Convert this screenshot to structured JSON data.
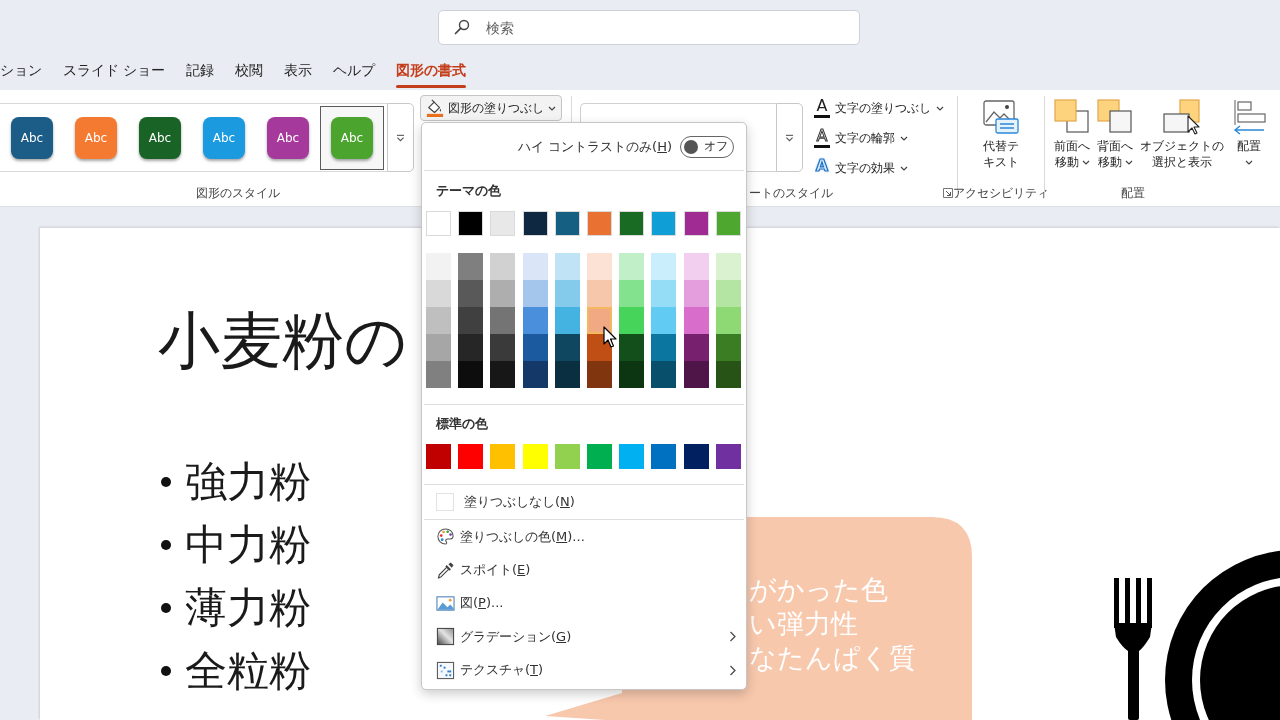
{
  "search": {
    "placeholder": "検索"
  },
  "tabs": [
    {
      "label": "ション",
      "selected": false
    },
    {
      "label": "スライド ショー",
      "selected": false
    },
    {
      "label": "記録",
      "selected": false
    },
    {
      "label": "校閲",
      "selected": false
    },
    {
      "label": "表示",
      "selected": false
    },
    {
      "label": "ヘルプ",
      "selected": false
    },
    {
      "label": "図形の書式",
      "selected": true
    }
  ],
  "ribbon": {
    "shape_styles": {
      "options": [
        {
          "label": "Abc",
          "color": "#1b5d87",
          "selected": false
        },
        {
          "label": "Abc",
          "color": "#f47a32",
          "selected": false
        },
        {
          "label": "Abc",
          "color": "#1a6326",
          "selected": false
        },
        {
          "label": "Abc",
          "color": "#1c9ae0",
          "selected": false
        },
        {
          "label": "Abc",
          "color": "#a63a9c",
          "selected": false
        },
        {
          "label": "Abc",
          "color": "#4aa42e",
          "selected": true
        }
      ],
      "label": "図形のスタイル"
    },
    "shape_fill_button": {
      "label": "図形の塗りつぶし",
      "dropdown": true
    },
    "wordart_styles": {
      "label": "ートのスタイル"
    },
    "text_buttons": [
      {
        "kind": "fill",
        "glyph": "A",
        "label": "文字の塗りつぶし",
        "dropdown": true
      },
      {
        "kind": "outline",
        "glyph": "A",
        "label": "文字の輪郭",
        "dropdown": true
      },
      {
        "kind": "effects",
        "glyph": "A",
        "label": "文字の効果",
        "dropdown": true
      }
    ],
    "accessibility": {
      "button": {
        "lines": [
          "代替テ",
          "キスト"
        ]
      },
      "label": "アクセシビリティ"
    },
    "arrange": {
      "buttons": [
        {
          "kind": "bring_forward",
          "lines": [
            "前面へ",
            "移動"
          ],
          "dropdown": true
        },
        {
          "kind": "send_backward",
          "lines": [
            "背面へ",
            "移動"
          ],
          "dropdown": true
        },
        {
          "kind": "selection_pane",
          "lines": [
            "オブジェクトの",
            "選択と表示"
          ],
          "dropdown": false
        },
        {
          "kind": "align",
          "lines": [
            "配置"
          ],
          "dropdown": true
        }
      ],
      "label": "配置"
    }
  },
  "fill_menu": {
    "high_contrast": {
      "label_before": "ハイ コントラストのみ(",
      "access_key": "H",
      "label_after": ")",
      "on": false,
      "state_text": "オフ"
    },
    "theme_colors": {
      "title": "テーマの色",
      "columns": [
        {
          "color": "#ffffff",
          "shades": [
            {
              "color": "#f2f2f2",
              "hovered": false
            },
            {
              "color": "#d9d9d9",
              "hovered": false
            },
            {
              "color": "#bfbfbf",
              "hovered": false
            },
            {
              "color": "#a6a6a6",
              "hovered": false
            },
            {
              "color": "#808080",
              "hovered": false
            }
          ]
        },
        {
          "color": "#000000",
          "shades": [
            {
              "color": "#7f7f7f",
              "hovered": false
            },
            {
              "color": "#595959",
              "hovered": false
            },
            {
              "color": "#404040",
              "hovered": false
            },
            {
              "color": "#262626",
              "hovered": false
            },
            {
              "color": "#0d0d0d",
              "hovered": false
            }
          ]
        },
        {
          "color": "#e8e8e8",
          "shades": [
            {
              "color": "#d1d1d1",
              "hovered": false
            },
            {
              "color": "#aeaeae",
              "hovered": false
            },
            {
              "color": "#747474",
              "hovered": false
            },
            {
              "color": "#3a3a3a",
              "hovered": false
            },
            {
              "color": "#171717",
              "hovered": false
            }
          ]
        },
        {
          "color": "#0e2841",
          "shades": [
            {
              "color": "#dae6f7",
              "hovered": false
            },
            {
              "color": "#a4c6ec",
              "hovered": false
            },
            {
              "color": "#4a8fdc",
              "hovered": false
            },
            {
              "color": "#1c5aa0",
              "hovered": false
            },
            {
              "color": "#143868",
              "hovered": false
            }
          ]
        },
        {
          "color": "#156082",
          "shades": [
            {
              "color": "#c0e4f5",
              "hovered": false
            },
            {
              "color": "#83caeb",
              "hovered": false
            },
            {
              "color": "#44b3e1",
              "hovered": false
            },
            {
              "color": "#0f4761",
              "hovered": false
            },
            {
              "color": "#0a2f41",
              "hovered": false
            }
          ]
        },
        {
          "color": "#e97132",
          "shades": [
            {
              "color": "#fbe2d5",
              "hovered": false
            },
            {
              "color": "#f7c7ac",
              "hovered": false
            },
            {
              "color": "#f1a983",
              "hovered": true
            },
            {
              "color": "#c04f15",
              "hovered": false
            },
            {
              "color": "#80350e",
              "hovered": false
            }
          ]
        },
        {
          "color": "#196b24",
          "shades": [
            {
              "color": "#c1f0c8",
              "hovered": false
            },
            {
              "color": "#83e28e",
              "hovered": false
            },
            {
              "color": "#47d45a",
              "hovered": false
            },
            {
              "color": "#124f1a",
              "hovered": false
            },
            {
              "color": "#0c3512",
              "hovered": false
            }
          ]
        },
        {
          "color": "#0f9ed5",
          "shades": [
            {
              "color": "#caeefb",
              "hovered": false
            },
            {
              "color": "#95dcf7",
              "hovered": false
            },
            {
              "color": "#61cbf3",
              "hovered": false
            },
            {
              "color": "#0b76a0",
              "hovered": false
            },
            {
              "color": "#074f6a",
              "hovered": false
            }
          ]
        },
        {
          "color": "#a02b93",
          "shades": [
            {
              "color": "#f2cfee",
              "hovered": false
            },
            {
              "color": "#e59edd",
              "hovered": false
            },
            {
              "color": "#d86dcb",
              "hovered": false
            },
            {
              "color": "#77206d",
              "hovered": false
            },
            {
              "color": "#4f1548",
              "hovered": false
            }
          ]
        },
        {
          "color": "#4ea72e",
          "shades": [
            {
              "color": "#daf2d0",
              "hovered": false
            },
            {
              "color": "#b4e5a2",
              "hovered": false
            },
            {
              "color": "#8ed973",
              "hovered": false
            },
            {
              "color": "#3a7d22",
              "hovered": false
            },
            {
              "color": "#275317",
              "hovered": false
            }
          ]
        }
      ]
    },
    "standard_colors": {
      "title": "標準の色",
      "colors": [
        {
          "color": "#c00000"
        },
        {
          "color": "#ff0000"
        },
        {
          "color": "#ffc000"
        },
        {
          "color": "#ffff00"
        },
        {
          "color": "#92d050"
        },
        {
          "color": "#00b050"
        },
        {
          "color": "#00b0f0"
        },
        {
          "color": "#0070c0"
        },
        {
          "color": "#002060"
        },
        {
          "color": "#7030a0"
        }
      ]
    },
    "no_fill": {
      "label_before": "塗りつぶしなし(",
      "access_key": "N",
      "label_after": ")"
    },
    "items": [
      {
        "kind": "more_colors",
        "label_before": "塗りつぶしの色(",
        "access_key": "M",
        "label_after": ")...",
        "submenu": false
      },
      {
        "kind": "eyedropper",
        "label_before": "スポイト(",
        "access_key": "E",
        "label_after": ")",
        "submenu": false
      },
      {
        "kind": "picture",
        "label_before": "図(",
        "access_key": "P",
        "label_after": ")...",
        "submenu": false
      },
      {
        "kind": "gradient",
        "label_before": "グラデーション(",
        "access_key": "G",
        "label_after": ")",
        "submenu": true
      },
      {
        "kind": "texture",
        "label_before": "テクスチャ(",
        "access_key": "T",
        "label_after": ")",
        "submenu": true
      }
    ]
  },
  "slide": {
    "title": "小麦粉の",
    "bullets": [
      "強力粉",
      "中力粉",
      "薄力粉",
      "全粒粉"
    ],
    "callout_lines": [
      "がかった色",
      "い弾力性",
      "なたんぱく質"
    ]
  }
}
